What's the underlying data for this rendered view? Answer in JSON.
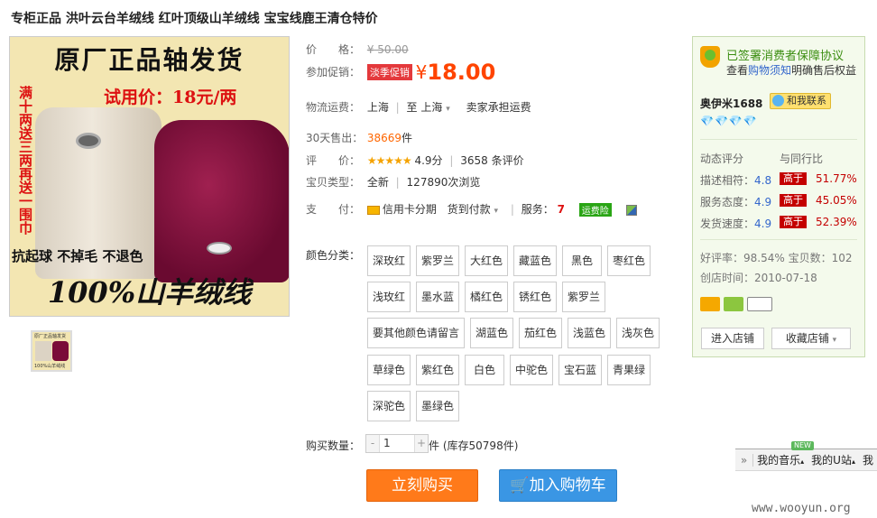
{
  "title": "专柜正品 洪叶云台羊绒线 红叶顶级山羊绒线 宝宝线鹿王清仓特价",
  "product_image": {
    "headline": "原厂正品轴发货",
    "price_tag": "试用价：18元/两",
    "side_text": "满十两送三两再送一围巾",
    "slogan": "抗起球 不掉毛 不退色",
    "bottom_text": "100%山羊绒线",
    "thumb_top": "原厂正品轴发货",
    "thumb_bottom": "100%山羊绒线"
  },
  "price": {
    "label": "价　　格：",
    "value": "¥ 50.00"
  },
  "promo": {
    "label": "参加促销：",
    "tag": "淡季促销",
    "yen": "¥",
    "value": "18.00"
  },
  "shipping": {
    "label": "物流运费：",
    "from": "上海",
    "to_prefix": "至",
    "to": "上海",
    "note": "卖家承担运费"
  },
  "sales": {
    "label": "30天售出：",
    "value": "38669",
    "unit": "件"
  },
  "rating": {
    "label": "评　　价：",
    "stars": "★★★★★",
    "score": "4.9分",
    "count": "3658 条评价"
  },
  "type": {
    "label": "宝贝类型：",
    "value": "全新",
    "views": "127890次浏览"
  },
  "payment": {
    "label": "支　　付：",
    "installment": "信用卡分期",
    "cod": "货到付款",
    "service_label": "服务：",
    "service_tag": "运费险"
  },
  "color": {
    "label": "颜色分类：",
    "options": [
      "深玫红",
      "紫罗兰",
      "大红色",
      "藏蓝色",
      "黑色",
      "枣红色",
      "浅玫红",
      "墨水蓝",
      "橘红色",
      "锈红色",
      "紫罗兰",
      "要其他颜色请留言",
      "湖蓝色",
      "茄红色",
      "浅蓝色",
      "浅灰色",
      "草绿色",
      "紫红色",
      "白色",
      "中驼色",
      "宝石蓝",
      "青果绿",
      "深驼色",
      "墨绿色"
    ]
  },
  "quantity": {
    "label": "购买数量：",
    "minus": "-",
    "value": "1",
    "plus": "+",
    "unit": "件",
    "stock": "(库存50798件)"
  },
  "buttons": {
    "buy_now": "立刻购买",
    "add_cart": "加入购物车"
  },
  "seller": {
    "guard_title": "已签署消费者保障协议",
    "guard_sub_prefix": "查看",
    "guard_sub_link": "购物须知",
    "guard_sub_suffix": "明确售后权益",
    "name": "奥伊米1688",
    "contact": "和我联系",
    "diamonds": "💎💎💎💎",
    "rating_head": "动态评分",
    "rating_compare": "与同行比",
    "ratings": [
      {
        "label": "描述相符：",
        "score": "4.8",
        "tag": "高于",
        "pct": "51.77%"
      },
      {
        "label": "服务态度：",
        "score": "4.9",
        "tag": "高于",
        "pct": "45.05%"
      },
      {
        "label": "发货速度：",
        "score": "4.9",
        "tag": "高于",
        "pct": "52.39%"
      }
    ],
    "praise": "好评率：98.54% 宝贝数：102",
    "created": "创店时间：2010-07-18",
    "enter_shop": "进入店铺",
    "fav_shop": "收藏店铺"
  },
  "toolbar": {
    "collapse": "»",
    "new_badge": "NEW",
    "music": "我的音乐",
    "u": "我的U站",
    "more": "我"
  },
  "watermark": "www.wooyun.org",
  "colors": {
    "accent_orange": "#ff4400",
    "buy_button": "#ff7a1a",
    "cart_button": "#3a96e4",
    "seller_green": "#3a8d10"
  }
}
